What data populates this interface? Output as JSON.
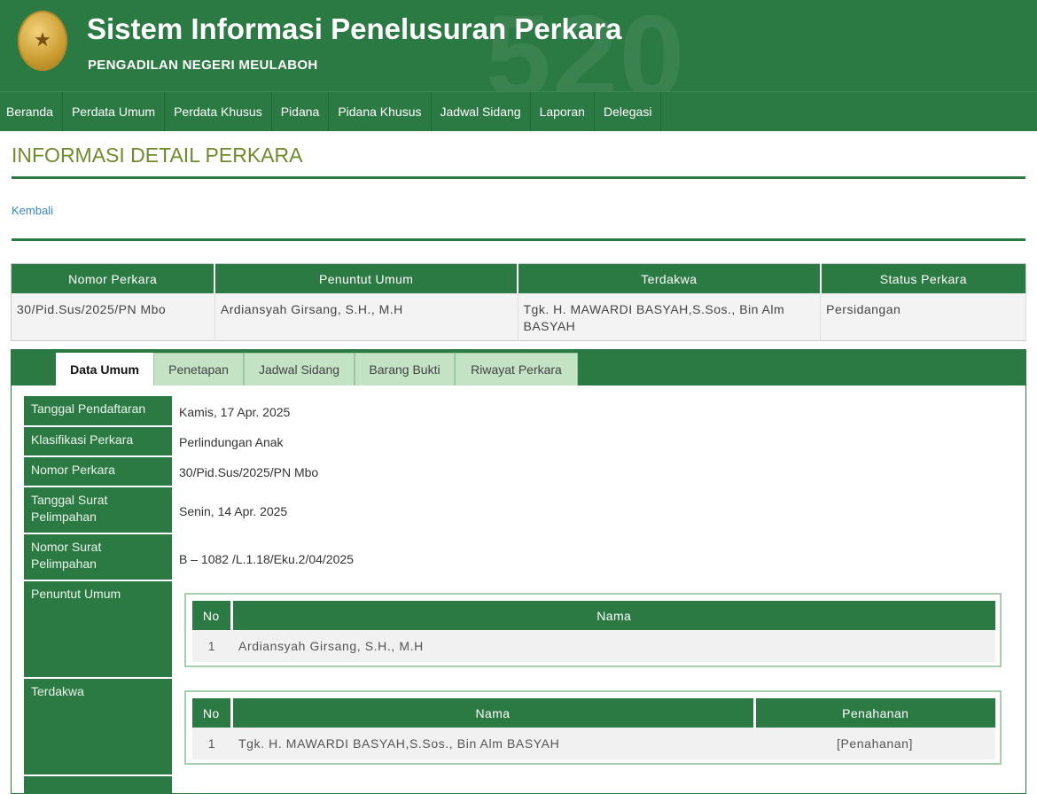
{
  "header": {
    "title": "Sistem Informasi Penelusuran Perkara",
    "subtitle": "PENGADILAN NEGERI MEULABOH",
    "watermark": "520"
  },
  "nav": [
    "Beranda",
    "Perdata Umum",
    "Perdata Khusus",
    "Pidana",
    "Pidana Khusus",
    "Jadwal Sidang",
    "Laporan",
    "Delegasi"
  ],
  "page": {
    "title": "INFORMASI DETAIL PERKARA",
    "back_link": "Kembali"
  },
  "summary": {
    "headers": [
      "Nomor Perkara",
      "Penuntut Umum",
      "Terdakwa",
      "Status Perkara"
    ],
    "row": [
      "30/Pid.Sus/2025/PN Mbo",
      "Ardiansyah Girsang, S.H., M.H",
      "Tgk. H. MAWARDI BASYAH,S.Sos., Bin Alm BASYAH",
      "Persidangan"
    ]
  },
  "tabs": [
    "Data Umum",
    "Penetapan",
    "Jadwal Sidang",
    "Barang Bukti",
    "Riwayat Perkara"
  ],
  "detail": {
    "tanggal_pendaftaran": {
      "label": "Tanggal Pendaftaran",
      "value": "Kamis, 17 Apr. 2025"
    },
    "klasifikasi": {
      "label": "Klasifikasi Perkara",
      "value": "Perlindungan Anak"
    },
    "nomor_perkara": {
      "label": "Nomor Perkara",
      "value": "30/Pid.Sus/2025/PN Mbo"
    },
    "tanggal_surat": {
      "label": "Tanggal Surat Pelimpahan",
      "value": "Senin, 14 Apr. 2025"
    },
    "nomor_surat": {
      "label": "Nomor Surat Pelimpahan",
      "value": "B – 1082 /L.1.18/Eku.2/04/2025"
    },
    "penuntut": {
      "label": "Penuntut Umum",
      "headers": [
        "No",
        "Nama"
      ],
      "rows": [
        {
          "no": "1",
          "nama": "Ardiansyah Girsang, S.H., M.H"
        }
      ]
    },
    "terdakwa": {
      "label": "Terdakwa",
      "headers": [
        "No",
        "Nama",
        "Penahanan"
      ],
      "rows": [
        {
          "no": "1",
          "nama": "Tgk. H. MAWARDI BASYAH,S.Sos., Bin Alm BASYAH",
          "penahanan": "[Penahanan]"
        }
      ]
    }
  },
  "colors": {
    "primary": "#2c7a43",
    "title_text": "#6e8c2c",
    "link": "#3b86c9",
    "tab_inactive": "#c3e3c4"
  }
}
